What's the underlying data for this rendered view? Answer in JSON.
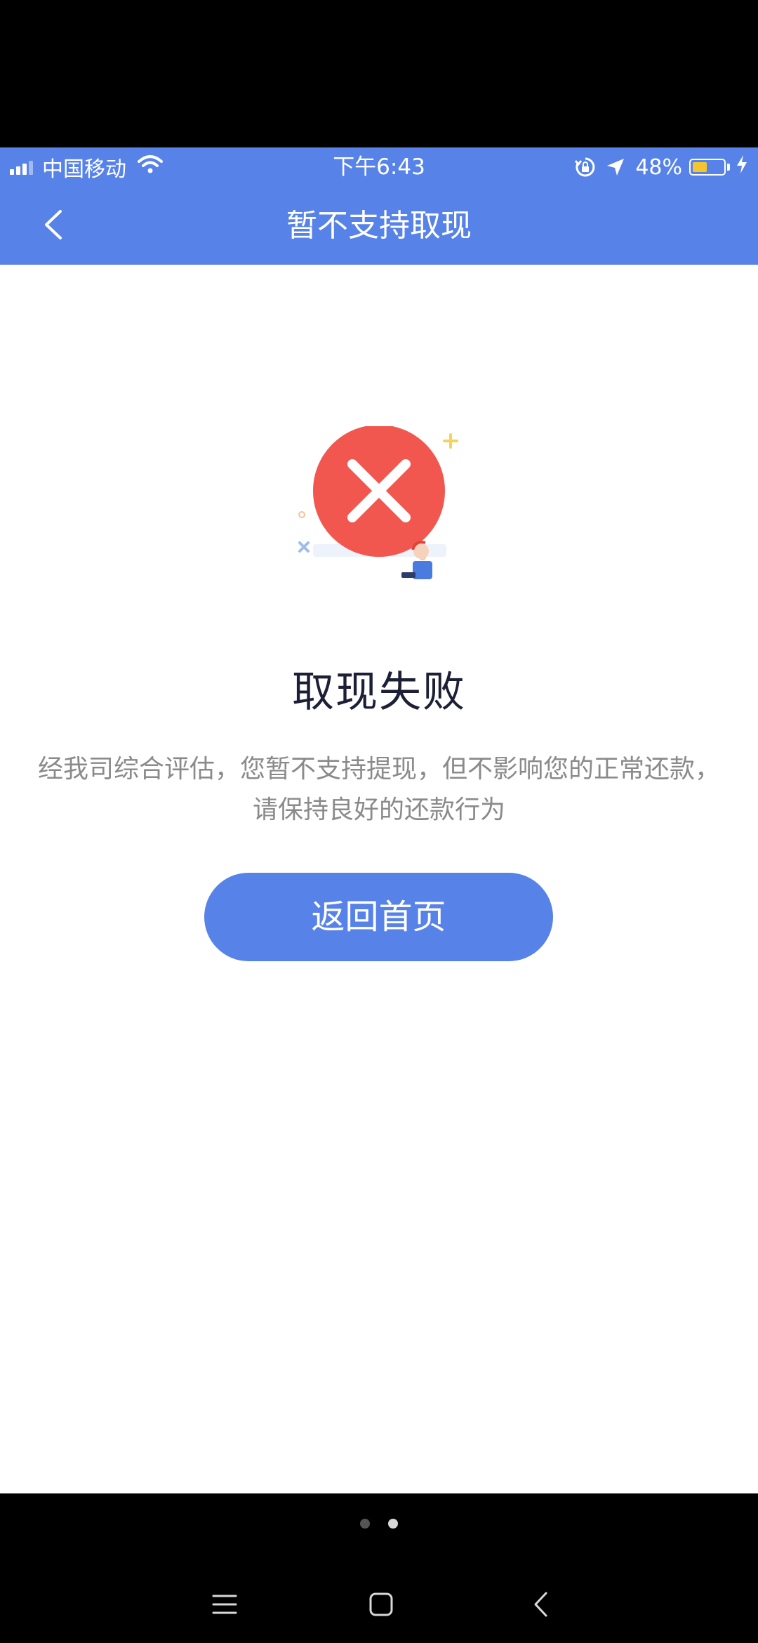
{
  "status_bar": {
    "carrier": "中国移动",
    "time": "下午6:43",
    "battery_percent_text": "48%",
    "battery_level": 0.48,
    "icons": [
      "signal-icon",
      "wifi-icon",
      "rotation-lock-icon",
      "location-arrow-icon",
      "battery-icon",
      "charging-bolt-icon"
    ]
  },
  "nav_bar": {
    "title": "暂不支持取现",
    "back_icon": "chevron-left-icon"
  },
  "result": {
    "illustration_icon": "error-x-icon",
    "title": "取现失败",
    "description_line1": "经我司综合评估，您暂不支持提现，但不影响您的正常还款，",
    "description_line2": "请保持良好的还款行为"
  },
  "actions": {
    "home_button_label": "返回首页"
  },
  "system_nav": {
    "page_dots": 2,
    "active_dot_index": 1,
    "icons": [
      "menu-icon",
      "home-square-icon",
      "back-chevron-icon"
    ]
  },
  "colors": {
    "primary": "#5782e8",
    "error_red": "#f1574e",
    "title_text": "#1c1f35",
    "description_text": "#8a8a8a"
  }
}
